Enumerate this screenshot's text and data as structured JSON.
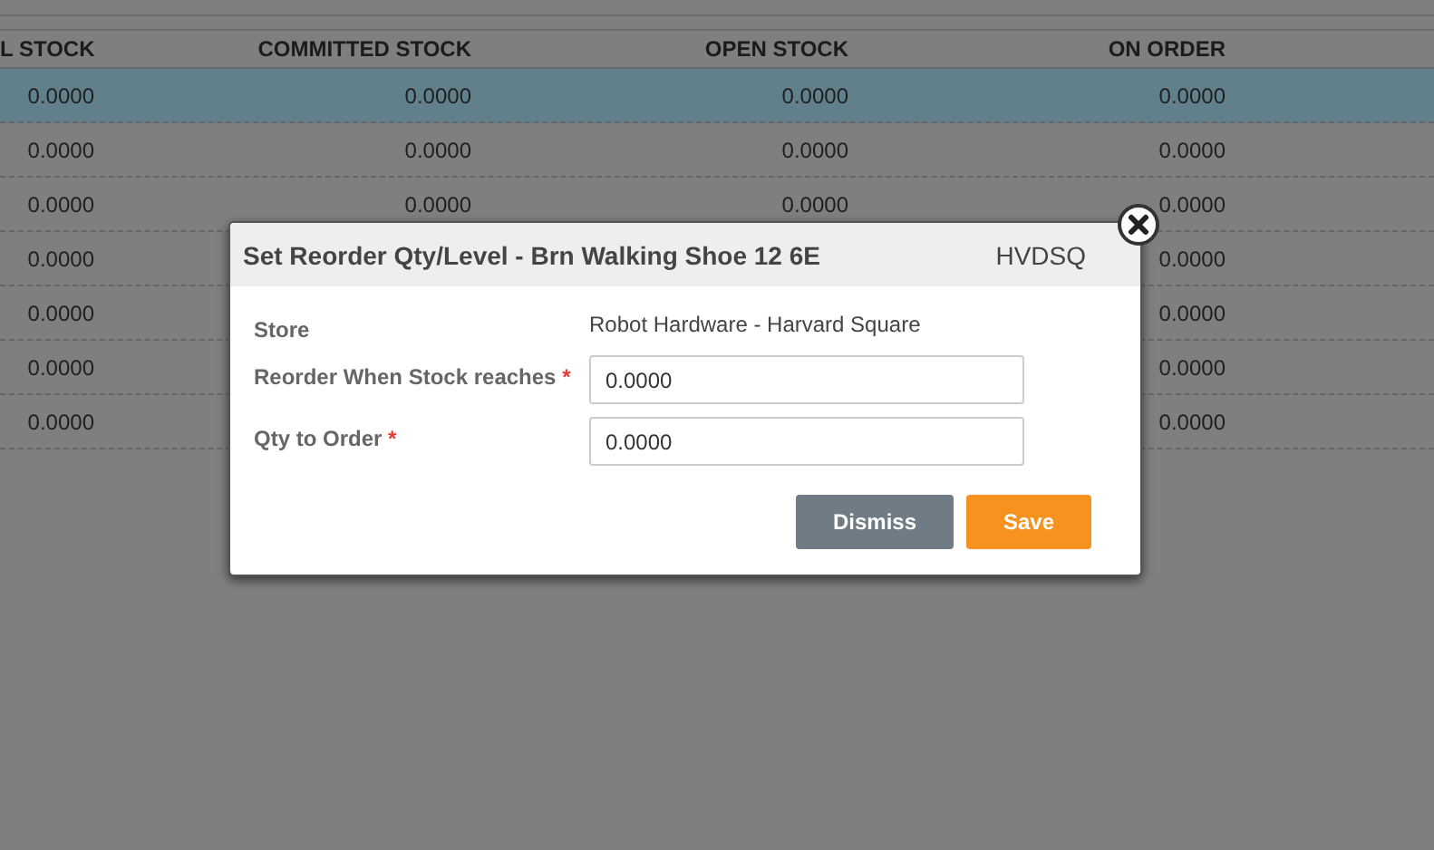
{
  "table": {
    "columns": [
      "L STOCK",
      "COMMITTED STOCK",
      "OPEN STOCK",
      "ON ORDER"
    ],
    "rows": [
      {
        "selected": true,
        "cells": [
          "0.0000",
          "0.0000",
          "0.0000",
          "0.0000"
        ]
      },
      {
        "selected": false,
        "cells": [
          "0.0000",
          "0.0000",
          "0.0000",
          "0.0000"
        ]
      },
      {
        "selected": false,
        "cells": [
          "0.0000",
          "0.0000",
          "0.0000",
          "0.0000"
        ]
      },
      {
        "selected": false,
        "cells": [
          "0.0000",
          null,
          null,
          "0.0000"
        ]
      },
      {
        "selected": false,
        "cells": [
          "0.0000",
          null,
          null,
          "0.0000"
        ]
      },
      {
        "selected": false,
        "cells": [
          "0.0000",
          null,
          null,
          "0.0000"
        ]
      },
      {
        "selected": false,
        "cells": [
          "0.0000",
          null,
          null,
          "0.0000"
        ]
      }
    ]
  },
  "dialog": {
    "title": "Set Reorder Qty/Level - Brn Walking Shoe 12 6E",
    "code": "HVDSQ",
    "store_label": "Store",
    "store_value": "Robot Hardware - Harvard Square",
    "fields": [
      {
        "label": "Reorder When Stock reaches",
        "required": true,
        "required_mark": "*",
        "value": "0.0000"
      },
      {
        "label": "Qty to Order",
        "required": true,
        "required_mark": "*",
        "value": "0.0000"
      }
    ],
    "buttons": [
      {
        "kind": "secondary",
        "label": "Dismiss"
      },
      {
        "kind": "primary",
        "label": "Save"
      }
    ]
  }
}
